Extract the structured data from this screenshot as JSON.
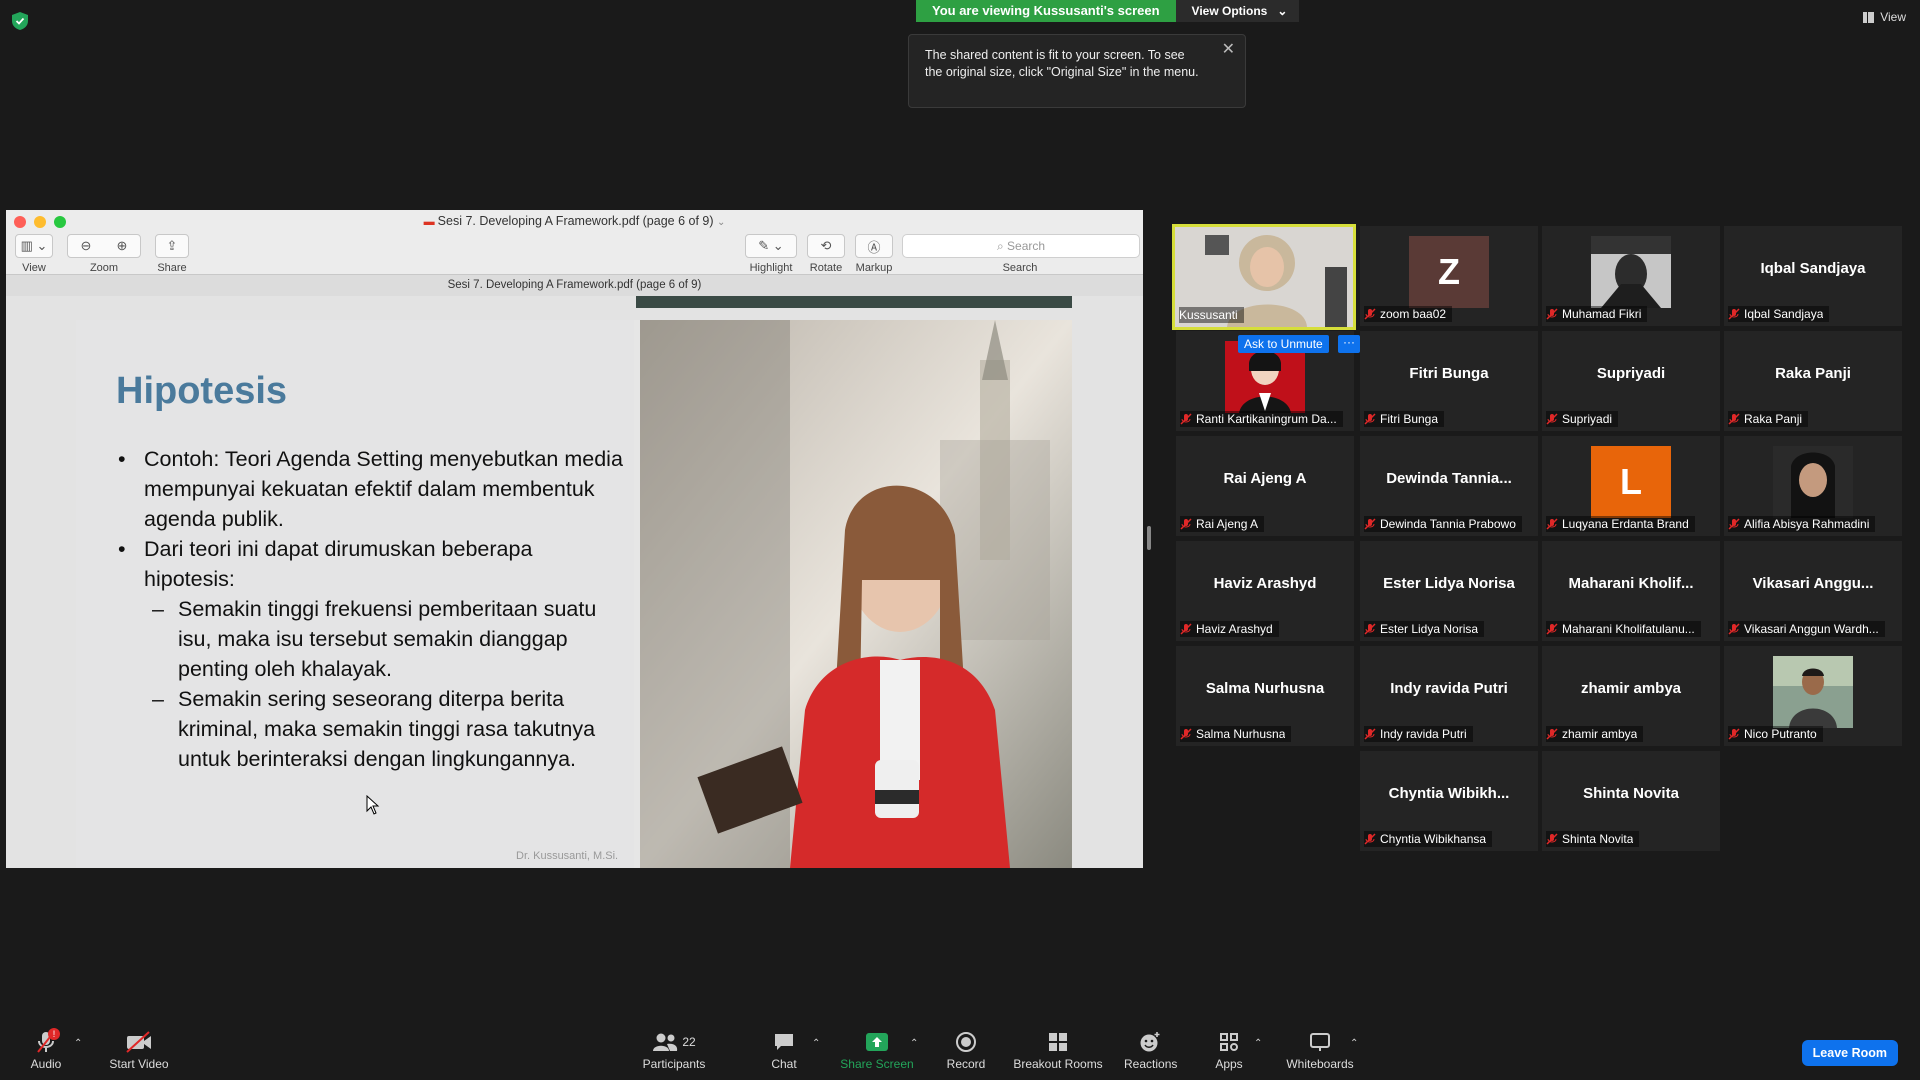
{
  "top": {
    "banner_text": "You are viewing Kussusanti's screen",
    "view_options": "View Options",
    "view_label": "View",
    "tooltip": "The shared content is fit to your screen. To see the original size, click \"Original Size\" in the menu."
  },
  "pdf": {
    "window_title": "Sesi 7. Developing A Framework.pdf (page 6 of 9)",
    "doc_title": "Sesi 7. Developing A Framework.pdf (page 6 of 9)",
    "toolbar": {
      "view": "View",
      "zoom": "Zoom",
      "share": "Share",
      "highlight": "Highlight",
      "rotate": "Rotate",
      "markup": "Markup",
      "search_placeholder": "Search",
      "search": "Search"
    },
    "slide": {
      "title": "Hipotesis",
      "bullet1": "Contoh: Teori Agenda Setting menyebutkan media mempunyai kekuatan efektif dalam membentuk agenda publik.",
      "bullet2": "Dari teori ini dapat dirumuskan beberapa hipotesis:",
      "sub1": "Semakin tinggi frekuensi pemberitaan suatu isu, maka isu tersebut semakin dianggap penting oleh khalayak.",
      "sub2": "Semakin sering seseorang diterpa berita kriminal, maka semakin tinggi rasa takutnya untuk berinteraksi dengan lingkungannya.",
      "author": "Dr. Kussusanti, M.Si."
    }
  },
  "participants": {
    "ask_to_unmute": "Ask to Unmute",
    "more": "···",
    "p1": {
      "label": "Kussusanti"
    },
    "p2": {
      "initial": "Z",
      "label": "zoom baa02",
      "color": "#5a3a36"
    },
    "p3": {
      "label": "Muhamad Fikri"
    },
    "p4": {
      "name": "Iqbal Sandjaya",
      "label": "Iqbal Sandjaya"
    },
    "p5": {
      "label": "Ranti Kartikaningrum Da..."
    },
    "p6": {
      "name": "Fitri Bunga",
      "label": "Fitri Bunga"
    },
    "p7": {
      "name": "Supriyadi",
      "label": "Supriyadi"
    },
    "p8": {
      "name": "Raka Panji",
      "label": "Raka Panji"
    },
    "p9": {
      "name": "Rai Ajeng A",
      "label": "Rai Ajeng A"
    },
    "p10": {
      "name": "Dewinda  Tannia...",
      "label": "Dewinda Tannia Prabowo"
    },
    "p11": {
      "initial": "L",
      "label": "Luqyana Erdanta Brand",
      "color": "#e8650a"
    },
    "p12": {
      "label": "Alifia Abisya Rahmadini"
    },
    "p13": {
      "name": "Haviz Arashyd",
      "label": "Haviz Arashyd"
    },
    "p14": {
      "name": "Ester Lidya Norisa",
      "label": "Ester Lidya Norisa"
    },
    "p15": {
      "name": "Maharani  Kholif...",
      "label": "Maharani Kholifatulanu..."
    },
    "p16": {
      "name": "Vikasari  Anggu...",
      "label": "Vikasari Anggun Wardh..."
    },
    "p17": {
      "name": "Salma Nurhusna",
      "label": "Salma Nurhusna"
    },
    "p18": {
      "name": "Indy ravida Putri",
      "label": "Indy ravida Putri"
    },
    "p19": {
      "name": "zhamir ambya",
      "label": "zhamir ambya"
    },
    "p20": {
      "label": "Nico Putranto"
    },
    "p21": {
      "name": "Chyntia  Wibikh...",
      "label": "Chyntia Wibikhansa"
    },
    "p22": {
      "name": "Shinta  Novita",
      "label": "Shinta  Novita"
    }
  },
  "toolbar": {
    "audio": "Audio",
    "audio_badge": "!",
    "start_video": "Start Video",
    "participants_count": "22",
    "participants": "Participants",
    "chat": "Chat",
    "share_screen": "Share Screen",
    "record": "Record",
    "breakout": "Breakout Rooms",
    "reactions": "Reactions",
    "apps": "Apps",
    "whiteboards": "Whiteboards",
    "leave": "Leave Room"
  },
  "colors": {
    "banner_green": "#2ea043",
    "active_border": "#d6de3a",
    "zoom_blue": "#0e72ed",
    "mic_off_red": "#e02828"
  }
}
